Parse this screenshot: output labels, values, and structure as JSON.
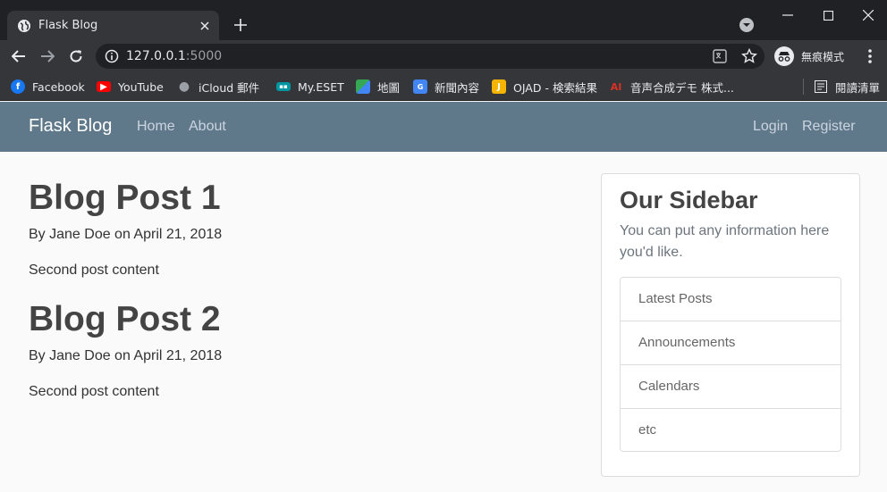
{
  "browser": {
    "tab_title": "Flask Blog",
    "url_host": "127.0.0.1",
    "url_port": ":5000",
    "incognito_label": "無痕模式",
    "bookmarks": [
      {
        "label": "Facebook",
        "icon": "facebook-icon",
        "color": "#1877f2"
      },
      {
        "label": "YouTube",
        "icon": "youtube-icon",
        "color": "#ff0000"
      },
      {
        "label": "iCloud 郵件",
        "icon": "apple-icon",
        "color": "#9aa0a6"
      },
      {
        "label": "My.ESET",
        "icon": "eset-icon",
        "color": "#0096a1"
      },
      {
        "label": "地圖",
        "icon": "maps-icon",
        "color": "#34a853"
      },
      {
        "label": "新聞內容",
        "icon": "news-icon",
        "color": "#4285f4"
      },
      {
        "label": "OJAD - 検索結果",
        "icon": "ojad-icon",
        "color": "#f4b400"
      },
      {
        "label": "音声合成デモ 株式...",
        "icon": "ai-icon",
        "color": "#d93025"
      }
    ],
    "reading_list": "閱讀清單"
  },
  "site": {
    "brand": "Flask Blog",
    "nav_left": [
      "Home",
      "About"
    ],
    "nav_right": [
      "Login",
      "Register"
    ],
    "nav_color": "#5f788a"
  },
  "posts": [
    {
      "title": "Blog Post 1",
      "meta": "By Jane Doe on April 21, 2018",
      "content": "Second post content"
    },
    {
      "title": "Blog Post 2",
      "meta": "By Jane Doe on April 21, 2018",
      "content": "Second post content"
    }
  ],
  "sidebar": {
    "title": "Our Sidebar",
    "description": "You can put any information here you'd like.",
    "items": [
      "Latest Posts",
      "Announcements",
      "Calendars",
      "etc"
    ]
  }
}
